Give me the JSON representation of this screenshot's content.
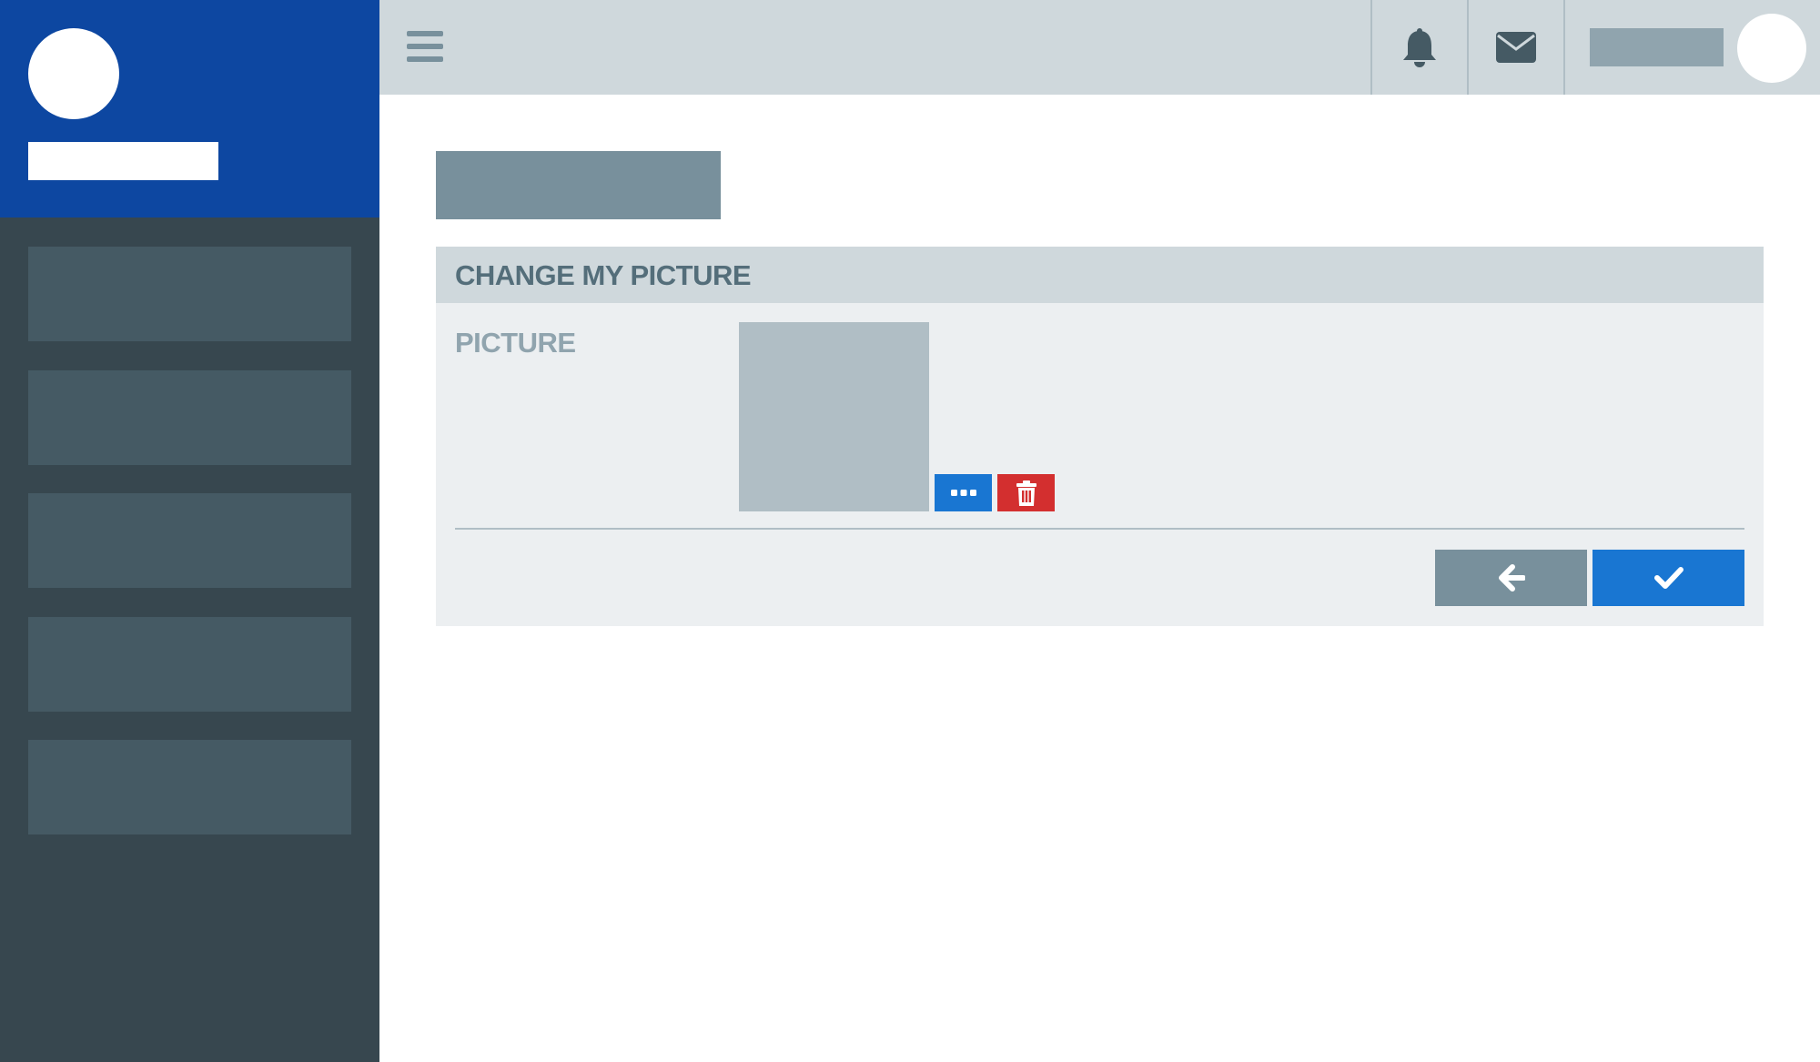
{
  "panel": {
    "title": "CHANGE MY PICTURE",
    "picture_label": "PICTURE"
  },
  "icons": {
    "menu": "hamburger-menu-icon",
    "notifications": "bell-icon",
    "messages": "envelope-icon",
    "browse": "ellipsis-icon",
    "delete": "trash-icon",
    "back": "arrow-left-icon",
    "confirm": "check-icon"
  },
  "colors": {
    "sidebar_header": "#0d47a1",
    "sidebar": "#37474f",
    "topbar": "#cfd8dc",
    "primary": "#1976d2",
    "danger": "#d32f2f",
    "secondary": "#78909c"
  }
}
